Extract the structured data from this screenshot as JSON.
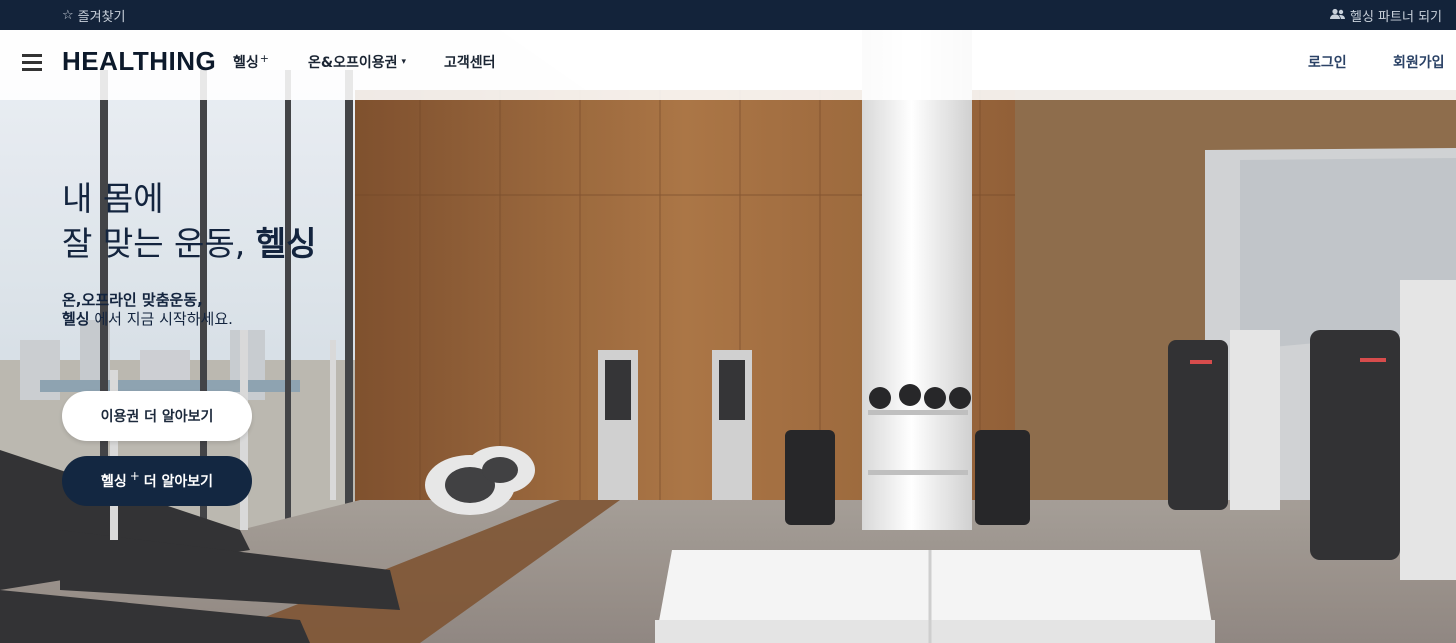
{
  "topbar": {
    "favorites_icon": "star-outline-icon",
    "favorites_label": "즐겨찾기",
    "partner_icon": "user-group-icon",
    "partner_label": "헬싱 파트너 되기"
  },
  "header": {
    "logo": "HEALTHING",
    "menu_icon": "hamburger-menu-icon",
    "nav": {
      "healthing": {
        "label": "헬싱",
        "suffix": "+"
      },
      "passes": {
        "label": "온&오프이용권",
        "caret": "▾"
      },
      "support": {
        "label": "고객센터"
      }
    },
    "login": "로그인",
    "signup": "회원가입"
  },
  "hero": {
    "headline_line1": "내 몸에",
    "headline_line2_a": "잘 맞는 운동, ",
    "headline_line2_b": "헬싱",
    "sub_line1": "온,오프라인 맞춤운동,",
    "sub_line2_bold": "헬싱",
    "sub_line2_rest": " 에서 지금 시작하세요.",
    "btn_pass": "이용권 더 알아보기",
    "btn_plus_a": "헬싱",
    "btn_plus_sup": "+",
    "btn_plus_b": "더 알아보기"
  },
  "colors": {
    "topbar_bg": "#13233a",
    "navy": "#132741",
    "link": "#2b4266"
  }
}
